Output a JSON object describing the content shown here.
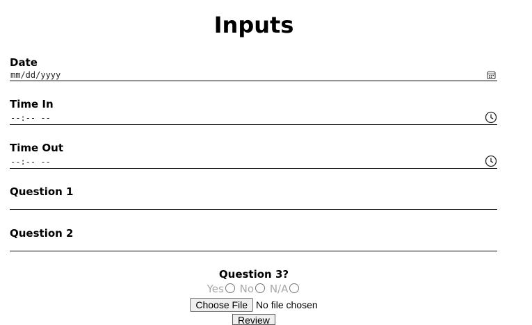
{
  "page": {
    "title": "Inputs"
  },
  "fields": [
    {
      "label": "Date",
      "value": "mm/dd/yyyy",
      "icon": "calendar-icon"
    },
    {
      "label": "Time In",
      "value": "--:-- --",
      "icon": "clock-icon"
    },
    {
      "label": "Time Out",
      "value": "--:-- --",
      "icon": "clock-icon"
    },
    {
      "label": "Question 1",
      "value": ""
    },
    {
      "label": "Question 2",
      "value": ""
    }
  ],
  "question3": {
    "label": "Question 3?",
    "options": [
      "Yes",
      "No",
      "N/A"
    ]
  },
  "file_input": {
    "button": "Choose File",
    "status": "No file chosen"
  },
  "review_button": "Review"
}
